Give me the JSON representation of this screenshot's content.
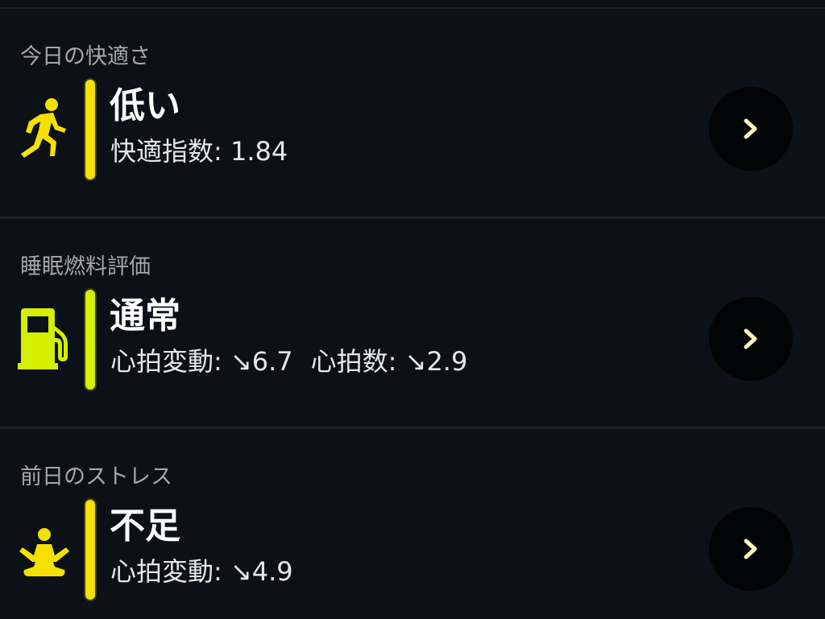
{
  "cards": [
    {
      "heading": "今日の快適さ",
      "value": "低い",
      "details": [
        "快適指数: 1.84"
      ],
      "icon": "running-person-icon",
      "accent_color": "#f5e000"
    },
    {
      "heading": "睡眠燃料評価",
      "value": "通常",
      "details": [
        "心拍変動: ↘6.7",
        "心拍数: ↘2.9"
      ],
      "icon": "fuel-pump-icon",
      "accent_color": "#d4f000"
    },
    {
      "heading": "前日のストレス",
      "value": "不足",
      "details": [
        "心拍変動: ↘4.9"
      ],
      "icon": "meditation-icon",
      "accent_color": "#f5e000"
    }
  ],
  "chevron_icon": "chevron-right-icon",
  "chevron_color": "#fff8c0"
}
